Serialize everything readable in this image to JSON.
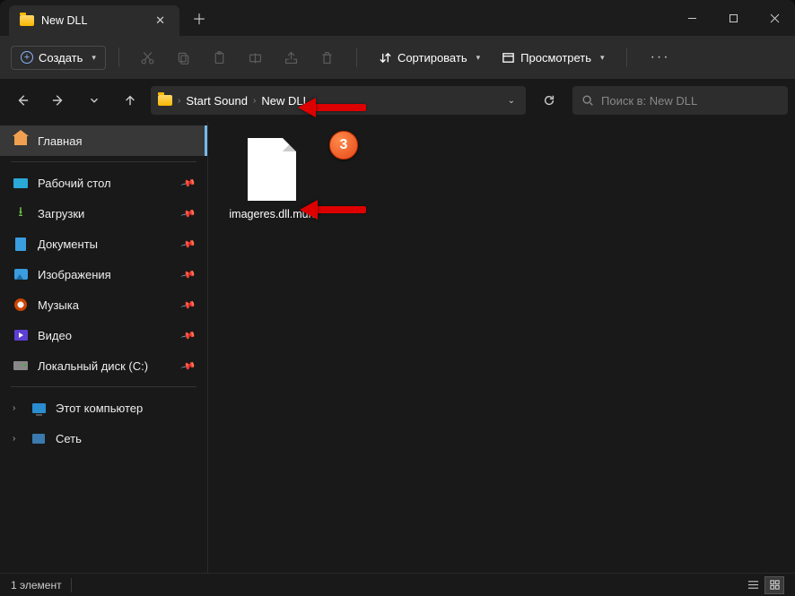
{
  "tab": {
    "title": "New DLL"
  },
  "toolbar": {
    "create": "Создать",
    "sort": "Сортировать",
    "view": "Просмотреть"
  },
  "breadcrumb": {
    "parent": "Start Sound",
    "current": "New DLL"
  },
  "search": {
    "placeholder": "Поиск в: New DLL"
  },
  "sidebar": {
    "home": "Главная",
    "desktop": "Рабочий стол",
    "downloads": "Загрузки",
    "documents": "Документы",
    "pictures": "Изображения",
    "music": "Музыка",
    "videos": "Видео",
    "drive_c": "Локальный диск (C:)",
    "this_pc": "Этот компьютер",
    "network": "Сеть"
  },
  "file": {
    "name": "imageres.dll.mun"
  },
  "annotation": {
    "badge": "3"
  },
  "status": {
    "count": "1 элемент"
  }
}
